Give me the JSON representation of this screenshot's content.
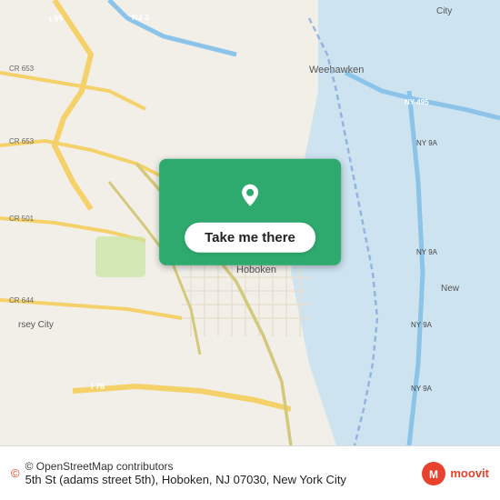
{
  "map": {
    "alt": "Map of Hoboken, NJ area",
    "center_label": "Hoboken"
  },
  "overlay": {
    "button_label": "Take me there",
    "pin_icon": "location-pin"
  },
  "footer": {
    "osm_text": "© OpenStreetMap contributors",
    "address": "5th St (adams street 5th), Hoboken, NJ 07030, New York City",
    "brand": "moovit"
  }
}
